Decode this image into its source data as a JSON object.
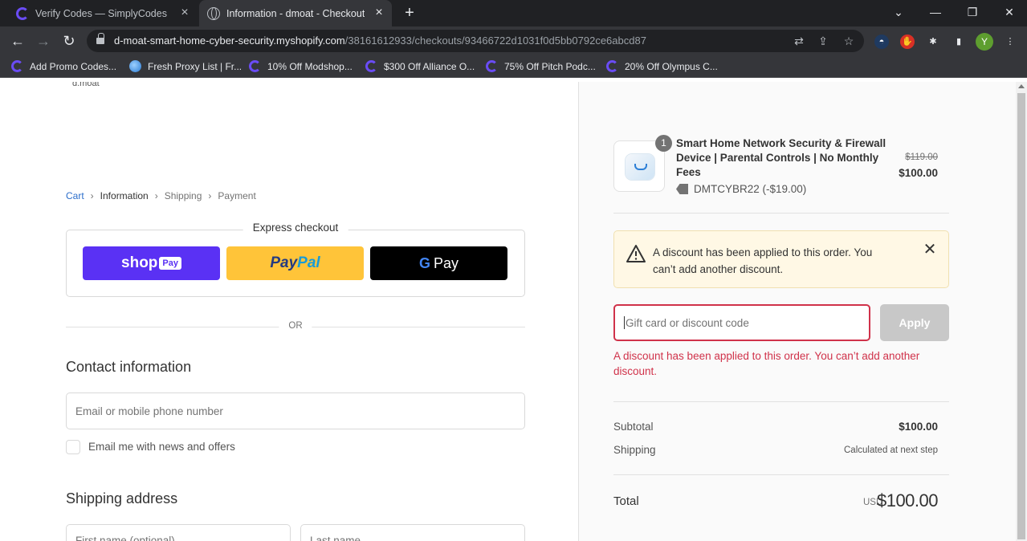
{
  "browser": {
    "tabs": [
      {
        "title": "Verify Codes — SimplyCodes",
        "active": false
      },
      {
        "title": "Information - dmoat - Checkout",
        "active": true
      }
    ],
    "url_host": "d-moat-smart-home-cyber-security.myshopify.com",
    "url_path": "/38161612933/checkouts/93466722d1031f0d5bb0792ce6abcd87",
    "profile_initial": "Y",
    "bookmarks": [
      {
        "label": "Add Promo Codes...",
        "icon": "simplycodes-icon"
      },
      {
        "label": "Fresh Proxy List | Fr...",
        "icon": "globe-icon"
      },
      {
        "label": "10% Off Modshop...",
        "icon": "simplycodes-icon"
      },
      {
        "label": "$300 Off Alliance O...",
        "icon": "simplycodes-icon"
      },
      {
        "label": "75% Off Pitch Podc...",
        "icon": "simplycodes-icon"
      },
      {
        "label": "20% Off Olympus C...",
        "icon": "simplycodes-icon"
      }
    ]
  },
  "checkout": {
    "logo_text": "d.moat",
    "breadcrumb": [
      "Cart",
      "Information",
      "Shipping",
      "Payment"
    ],
    "express_title": "Express checkout",
    "express_buttons": {
      "shop_pay": "shop",
      "shop_pay_chip": "Pay",
      "paypal_1": "Pay",
      "paypal_2": "Pal",
      "gpay_g": "G",
      "gpay_text": "Pay"
    },
    "or_text": "OR",
    "contact_title": "Contact information",
    "email_placeholder": "Email or mobile phone number",
    "newsletter_label": "Email me with news and offers",
    "shipping_title": "Shipping address",
    "first_name_placeholder": "First name (optional)",
    "last_name_placeholder": "Last name"
  },
  "summary": {
    "quantity": "1",
    "product_name": "Smart Home Network Security & Firewall Device | Parental Controls | No Monthly Fees",
    "price_original": "$119.00",
    "price_discounted": "$100.00",
    "discount_code": "DMTCYBR22 (-$19.00)",
    "notice_text": "A discount has been applied to this order. You can’t add another discount.",
    "code_placeholder": "Gift card or discount code",
    "apply_label": "Apply",
    "error_text": "A discount has been applied to this order. You can’t add another discount.",
    "subtotal_label": "Subtotal",
    "subtotal_value": "$100.00",
    "shipping_label": "Shipping",
    "shipping_value": "Calculated at next step",
    "total_label": "Total",
    "total_currency": "USD",
    "total_value": "$100.00"
  },
  "colors": {
    "shop_pay": "#5a31f4",
    "paypal": "#ffc439",
    "error": "#d0324a",
    "link": "#2c6ecb"
  }
}
